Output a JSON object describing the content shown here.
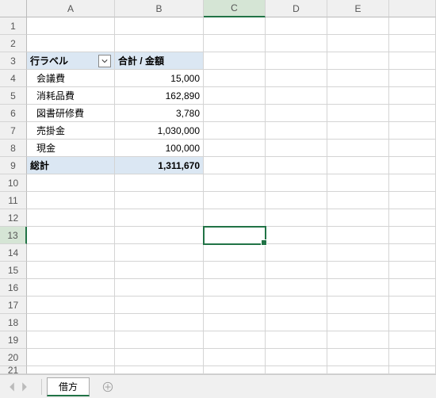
{
  "columns": [
    "A",
    "B",
    "C",
    "D",
    "E"
  ],
  "rows": [
    "1",
    "2",
    "3",
    "4",
    "5",
    "6",
    "7",
    "8",
    "9",
    "10",
    "11",
    "12",
    "13",
    "14",
    "15",
    "16",
    "17",
    "18",
    "19",
    "20",
    "21"
  ],
  "pivot": {
    "row_label_header": "行ラベル",
    "value_header": "合計 / 金額",
    "items": [
      {
        "label": "会議費",
        "value": "15,000"
      },
      {
        "label": "消耗品費",
        "value": "162,890"
      },
      {
        "label": "図書研修費",
        "value": "3,780"
      },
      {
        "label": "売掛金",
        "value": "1,030,000"
      },
      {
        "label": "現金",
        "value": "100,000"
      }
    ],
    "total_label": "総計",
    "total_value": "1,311,670"
  },
  "active_cell": "C13",
  "sheet_tab": "借方",
  "chart_data": {
    "type": "table",
    "title": "合計 / 金額",
    "categories": [
      "会議費",
      "消耗品費",
      "図書研修費",
      "売掛金",
      "現金",
      "総計"
    ],
    "values": [
      15000,
      162890,
      3780,
      1030000,
      100000,
      1311670
    ]
  }
}
